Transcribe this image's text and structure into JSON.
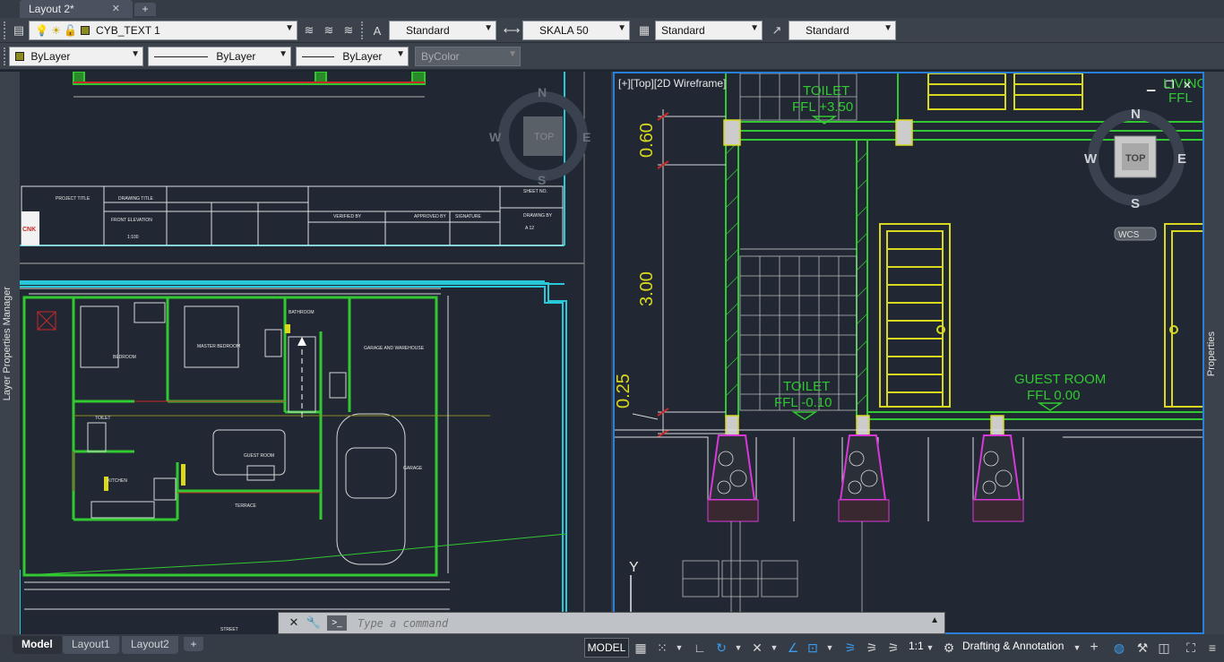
{
  "document_tabs": [
    {
      "label": "Layout 2*",
      "close": "✕"
    }
  ],
  "toolbar1": {
    "layer_name": "CYB_TEXT 1",
    "text_style": "Standard",
    "dim_style": "SKALA 50",
    "table_style": "Standard",
    "mleader_style": "Standard"
  },
  "toolbar2": {
    "color": "ByLayer",
    "linetype": "ByLayer",
    "lineweight": "ByLayer",
    "plotstyle": "ByColor"
  },
  "side_panels": {
    "left": "Layer Properties Manager",
    "right": "Properties"
  },
  "viewport_right": {
    "label": "[+][Top][2D Wireframe]",
    "viewcube": {
      "north": "N",
      "south": "S",
      "east": "E",
      "west": "W",
      "top": "TOP",
      "wcs": "WCS"
    }
  },
  "viewport_left": {
    "viewcube": {
      "north": "N",
      "south": "S",
      "east": "E",
      "west": "W",
      "top": "TOP"
    }
  },
  "drawing_right": {
    "dim_060": "0.60",
    "dim_300": "3.00",
    "dim_025": "0.25",
    "toilet_upper": "TOILET",
    "toilet_upper_ffl": "FFL +3.50",
    "toilet_lower": "TOILET",
    "toilet_lower_ffl": "FFL -0.10",
    "guest_room": "GUEST ROOM",
    "guest_room_ffl": "FFL 0.00",
    "corner_text": "LIVING",
    "corner_ffl": "FFL"
  },
  "drawing_left": {
    "title_block": {
      "project_title": "PROJECT TITLE",
      "drawing_title": "DRAWING TITLE",
      "sheet_value": "FRONT ELEVATION",
      "scale": "1:100",
      "sheet_no_label": "SHEET NO.",
      "sheet_no": "A 12",
      "verified_by": "VERIFIED BY",
      "approved_by": "APPROVED BY",
      "signature": "SIGNATURE",
      "drawing_by": "DRAWING BY",
      "logo": "CNK"
    },
    "rooms": {
      "bedroom": "BEDROOM",
      "master_bedroom": "MASTER BEDROOM",
      "bathroom": "BATHROOM",
      "garage_warehouse": "GARAGE AND WAREHOUSE",
      "toilet": "TOILET",
      "guest_room": "GUEST ROOM",
      "kitchen": "KITCHEN",
      "terrace": "TERRACE",
      "garage": "GARAGE",
      "street": "STREET"
    }
  },
  "command_line": {
    "placeholder": "Type a command"
  },
  "layout_tabs": [
    {
      "label": "Model"
    },
    {
      "label": "Layout1"
    },
    {
      "label": "Layout2"
    }
  ],
  "status_bar": {
    "model": "MODEL",
    "scale": "1:1",
    "workspace": "Drafting & Annotation"
  }
}
